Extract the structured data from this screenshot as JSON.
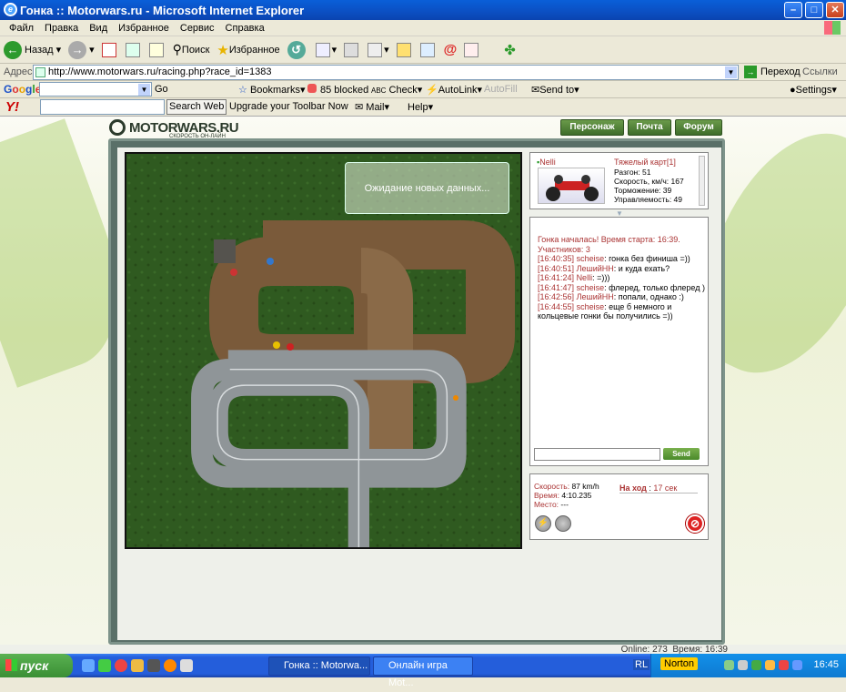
{
  "window": {
    "title": "Гонка :: Motorwars.ru - Microsoft Internet Explorer"
  },
  "menu": [
    "Файл",
    "Правка",
    "Вид",
    "Избранное",
    "Сервис",
    "Справка"
  ],
  "toolbar": {
    "back": "Назад",
    "search": "Поиск",
    "favorites": "Избранное"
  },
  "address": {
    "label": "Адрес:",
    "url": "http://www.motorwars.ru/racing.php?race_id=1383",
    "go": "Переход",
    "links": "Ссылки"
  },
  "google": {
    "go": "Go",
    "bookmarks": "Bookmarks",
    "blocked": "85 blocked",
    "check": "Check",
    "autolink": "AutoLink",
    "autofill": "AutoFill",
    "sendto": "Send to",
    "settings": "Settings"
  },
  "yahoo": {
    "search_web": "Search Web",
    "upgrade": "Upgrade your Toolbar Now",
    "mail": "Mail",
    "help": "Help"
  },
  "site": {
    "logo": "MOTORWARS.RU",
    "tagline": "СКОРОСТЬ ОН-ЛАЙН",
    "nav": [
      "Персонаж",
      "Почта",
      "Форум"
    ]
  },
  "track": {
    "status_message": "Ожидание новых данных..."
  },
  "player": {
    "name": "Nelli",
    "kart": "Тяжелый карт[1]",
    "stats": [
      "Разгон: 51",
      "Скорость, км/ч: 167",
      "Торможение: 39",
      "Управляемость: 49"
    ]
  },
  "chat": {
    "system": [
      "Гонка началась! Время старта: 16:39.",
      "Участников: 3"
    ],
    "messages": [
      {
        "time": "[16:40:35]",
        "user": "scheise",
        "text": "гонка без финиша =))"
      },
      {
        "time": "[16:40:51]",
        "user": "ЛешийНН",
        "text": "и куда ехать?"
      },
      {
        "time": "[16:41:24]",
        "user": "Nelli",
        "text": "=)))"
      },
      {
        "time": "[16:41:47]",
        "user": "scheise",
        "text": "флеред, только флеред )"
      },
      {
        "time": "[16:42:56]",
        "user": "ЛешийНН",
        "text": "попали, однако :)"
      },
      {
        "time": "[16:44:55]",
        "user": "scheise",
        "text": "еще б немного и кольцевые гонки бы получились =))"
      }
    ],
    "send": "Send"
  },
  "race": {
    "speed_label": "Скорость:",
    "speed_value": "87 km/h",
    "time_label": "Время:",
    "time_value": "4:10.235",
    "place_label": "Место:",
    "place_value": "---",
    "turn_label": "На ход",
    "turn_value": "17 сек"
  },
  "footer": {
    "online": "Online: 273",
    "time_label": "Время: 16:39"
  },
  "taskbar": {
    "start": "пуск",
    "tasks": [
      "Гонка :: Motorwa...",
      "Онлайн игра Mot..."
    ],
    "lang": "RL",
    "norton": "Norton",
    "clock": "16:45"
  },
  "colors": {
    "accent": "#3e6d2a",
    "chat_time": "#aa3333",
    "race_label": "#aa3333"
  }
}
